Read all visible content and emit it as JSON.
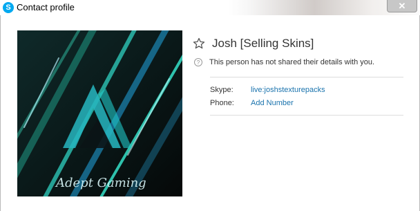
{
  "window": {
    "title": "Contact profile",
    "close_label": "✕"
  },
  "profile": {
    "name": "Josh [Selling Skins]",
    "privacy_notice": "This person has not shared their details with you.",
    "avatar_caption": "Adept Gaming",
    "avatar_letter": "A"
  },
  "details": [
    {
      "label": "Skype:",
      "value": "live:joshstexturepacks"
    },
    {
      "label": "Phone:",
      "value": "Add Number"
    }
  ],
  "colors": {
    "accent": "#00a9f0",
    "link": "#1a73ad"
  }
}
